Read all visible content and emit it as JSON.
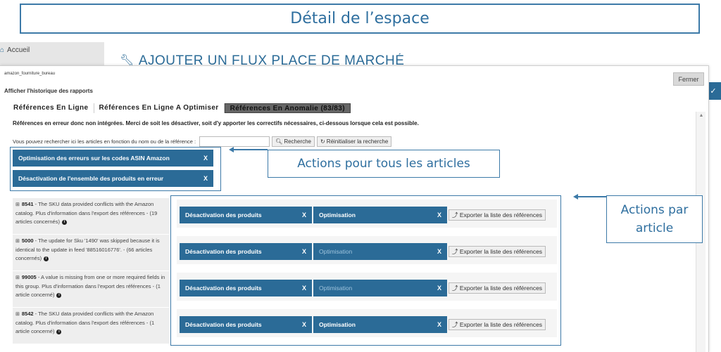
{
  "title": "Détail de l’espace",
  "background": {
    "home_label": "Accueil",
    "page_heading": "AJOUTER UN FLUX PLACE DE MARCHÉ",
    "right_tab_glyph": "✓"
  },
  "modal": {
    "feed_name": "amazon_fourniture_bureau",
    "close_label": "Fermer",
    "history_label": "Afficher l'historique des rapports",
    "tabs": [
      {
        "label": "Références En Ligne",
        "active": false
      },
      {
        "label": "Références En Ligne A Optimiser",
        "active": false
      },
      {
        "label": "Références En Anomalie (83/83)",
        "active": true
      }
    ],
    "error_note": "Références en erreur donc non intégrées. Merci de soit les désactiver, soit d'y apporter les correctifs nécessaires, ci-dessous lorsque cela est possible.",
    "search": {
      "label": "Vous pouvez rechercher ici les articles en fonction du nom ou de la référence :",
      "value": "",
      "search_button": "Recherche",
      "reset_button": "Réinitialiser la recherche"
    },
    "global_actions": [
      {
        "label": "Optimisation des erreurs sur les codes ASIN Amazon",
        "close": "X"
      },
      {
        "label": "Désactivation de l'ensemble des produits en erreur",
        "close": "X"
      }
    ],
    "errors": [
      {
        "code": "8541",
        "text": " - The SKU data provided conflicts with the Amazon catalog. Plus d'information dans l'export des références - (19 articles concernés)"
      },
      {
        "code": "5000",
        "text": " - The update for Sku '1490' was skipped because it is identical to the update in feed '88516016776'. - (66 articles concernés)"
      },
      {
        "code": "99005",
        "text": " - A value is missing from one or more required fields in this group. Plus d'information dans l'export des références - (1 article concerné)"
      },
      {
        "code": "8542",
        "text": " - The SKU data provided conflicts with the Amazon catalog. Plus d'information dans l'export des références - (1 article concerné)"
      }
    ],
    "row_actions": {
      "deactivate_label": "Désactivation des produits",
      "optimize_label": "Optimisation",
      "close": "X",
      "export_label": "Exporter la liste des références",
      "rows": [
        {
          "optimize_enabled": true
        },
        {
          "optimize_enabled": false
        },
        {
          "optimize_enabled": false
        },
        {
          "optimize_enabled": true
        }
      ]
    }
  },
  "callouts": {
    "all_articles": "Actions pour tous les articles",
    "per_article_line1": "Actions par",
    "per_article_line2": "article"
  },
  "colors": {
    "accent": "#2b6b97",
    "annotation": "#3d7aa8"
  },
  "icons": [
    "home-icon",
    "wrench-icon",
    "search-icon",
    "refresh-icon",
    "export-icon",
    "info-icon",
    "plus-square-icon"
  ]
}
